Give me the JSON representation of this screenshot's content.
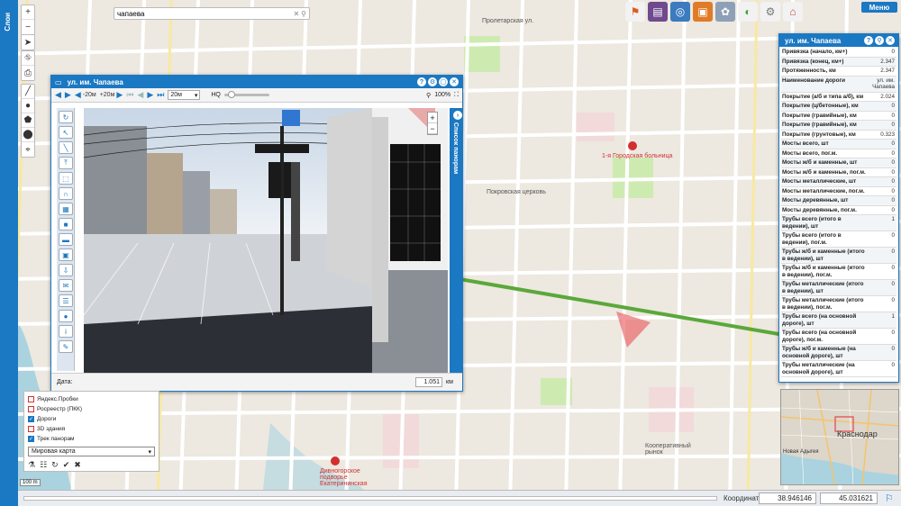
{
  "app": {
    "layers_bar_label": "Слои",
    "menu_label": "Меню"
  },
  "search": {
    "value": "чапаева"
  },
  "map_labels": {
    "hospital": "1-я Городская больница",
    "church": "Покровская церковь",
    "diocese": "Дивногорское подворье Екатерининская",
    "cooperative": "Кооперативный рынок",
    "proletarian": "Пролетарская ул."
  },
  "panorama": {
    "title": "ул. им. Чапаева",
    "step_back": "-20м",
    "step_fwd": "+20м",
    "step_select": "20м",
    "quality": "HQ",
    "zoom_pct": "100%",
    "side_list_label": "Список панорам",
    "date_label": "Дата:",
    "distance_value": "1.051",
    "distance_unit": "км"
  },
  "attributes": {
    "title": "ул. им. Чапаева",
    "rows": [
      {
        "k": "Привязка (начало, км+)",
        "v": "0"
      },
      {
        "k": "Привязка (конец, км+)",
        "v": "2.347"
      },
      {
        "k": "Протяженность, км",
        "v": "2.347"
      },
      {
        "k": "Наименование дороги",
        "v": "ул. им. Чапаева"
      },
      {
        "k": "Покрытие (а/б и типа а/б), км",
        "v": "2.024"
      },
      {
        "k": "Покрытие (ц/бетонные), км",
        "v": "0"
      },
      {
        "k": "Покрытие (гравийные), км",
        "v": "0"
      },
      {
        "k": "Покрытие (гравийные), км",
        "v": "0"
      },
      {
        "k": "Покрытие (грунтовые), км",
        "v": "0.323"
      },
      {
        "k": "Мосты всего, шт",
        "v": "0"
      },
      {
        "k": "Мосты всего, пог.м.",
        "v": "0"
      },
      {
        "k": "Мосты ж/б и каменные, шт",
        "v": "0"
      },
      {
        "k": "Мосты ж/б и каменные, пог.м.",
        "v": "0"
      },
      {
        "k": "Мосты металлические, шт",
        "v": "0"
      },
      {
        "k": "Мосты металлические, пог.м.",
        "v": "0"
      },
      {
        "k": "Мосты деревянные, шт",
        "v": "0"
      },
      {
        "k": "Мосты деревянные, пог.м.",
        "v": "0"
      },
      {
        "k": "Трубы всего (итого в ведении), шт",
        "v": "1"
      },
      {
        "k": "Трубы всего (итого в ведении), пог.м.",
        "v": "0"
      },
      {
        "k": "Трубы ж/б и каменные (итого в ведении), шт",
        "v": "0"
      },
      {
        "k": "Трубы ж/б и каменные (итого в ведении), пог.м.",
        "v": "0"
      },
      {
        "k": "Трубы металлические (итого в ведении), шт",
        "v": "0"
      },
      {
        "k": "Трубы металлические (итого в ведении), пог.м.",
        "v": "0"
      },
      {
        "k": "Трубы всего (на основной дороге), шт",
        "v": "1"
      },
      {
        "k": "Трубы всего (на основной дороге), пог.м.",
        "v": "0"
      },
      {
        "k": "Трубы ж/б и каменные (на основной дороге), шт",
        "v": "0"
      },
      {
        "k": "Трубы металлические (на основной дороге), шт",
        "v": "0"
      }
    ]
  },
  "minimap": {
    "city": "Краснодар",
    "area": "Новая Адыгея"
  },
  "layers": {
    "items": [
      {
        "label": "Яндекс.Пробки",
        "checked": false
      },
      {
        "label": "Росреестр (ПКК)",
        "checked": false
      },
      {
        "label": "Дороги",
        "checked": true
      },
      {
        "label": "3D здания",
        "checked": false
      },
      {
        "label": "Трек панорам",
        "checked": true
      }
    ],
    "basemap": "Мировая карта",
    "scale": "100 m"
  },
  "status": {
    "coord_label": "Координаты:",
    "lon": "38.946146",
    "lat": "45.031621"
  },
  "colors": {
    "accent": "#1b78c2",
    "road_green": "#5aa83a",
    "highlight": "#e7434a"
  }
}
